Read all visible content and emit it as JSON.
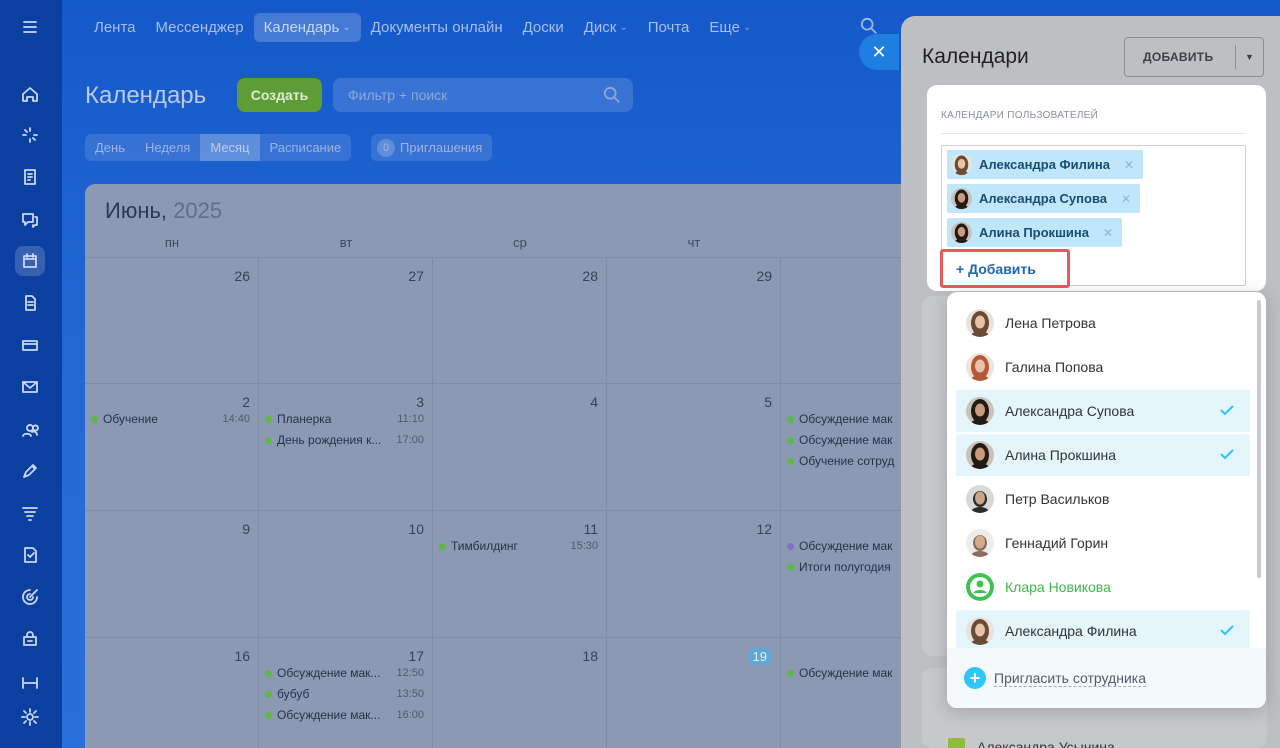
{
  "topnav": {
    "items": [
      {
        "label": "Лента",
        "dropdown": false,
        "active": false
      },
      {
        "label": "Мессенджер",
        "dropdown": false,
        "active": false
      },
      {
        "label": "Календарь",
        "dropdown": true,
        "active": true
      },
      {
        "label": "Документы онлайн",
        "dropdown": false,
        "active": false
      },
      {
        "label": "Доски",
        "dropdown": false,
        "active": false
      },
      {
        "label": "Диск",
        "dropdown": true,
        "active": false
      },
      {
        "label": "Почта",
        "dropdown": false,
        "active": false
      },
      {
        "label": "Еще",
        "dropdown": true,
        "active": false
      }
    ]
  },
  "header": {
    "title": "Календарь",
    "create_label": "Создать",
    "filter_placeholder": "Фильтр + поиск"
  },
  "views": {
    "tabs": [
      "День",
      "Неделя",
      "Месяц",
      "Расписание"
    ],
    "active": "Месяц",
    "invitations_count": "0",
    "invitations_label": "Приглашения"
  },
  "calendar": {
    "month": "Июнь,",
    "year": "2025",
    "weekdays": [
      "пн",
      "вт",
      "ср",
      "чт"
    ],
    "weeks": [
      {
        "days": [
          {
            "num": "26",
            "events": []
          },
          {
            "num": "27",
            "events": []
          },
          {
            "num": "28",
            "events": []
          },
          {
            "num": "29",
            "events": []
          },
          {
            "num": "",
            "events": []
          }
        ]
      },
      {
        "days": [
          {
            "num": "2",
            "events": [
              {
                "title": "Обучение",
                "time": "14:40",
                "color": "#5db846"
              }
            ]
          },
          {
            "num": "3",
            "events": [
              {
                "title": "Планерка",
                "time": "11:10",
                "color": "#5db846"
              },
              {
                "title": "День рождения к...",
                "time": "17:00",
                "color": "#5db846"
              }
            ]
          },
          {
            "num": "4",
            "events": []
          },
          {
            "num": "5",
            "events": []
          },
          {
            "num": "",
            "events": [
              {
                "title": "Обсуждение мак",
                "time": "",
                "color": "#5db846"
              },
              {
                "title": "Обсуждение мак",
                "time": "",
                "color": "#5db846"
              },
              {
                "title": "Обучение сотруд",
                "time": "",
                "color": "#5db846"
              }
            ]
          }
        ]
      },
      {
        "days": [
          {
            "num": "9",
            "events": []
          },
          {
            "num": "10",
            "events": []
          },
          {
            "num": "11",
            "events": [
              {
                "title": "Тимбилдинг",
                "time": "15:30",
                "color": "#5db846"
              }
            ]
          },
          {
            "num": "12",
            "events": []
          },
          {
            "num": "",
            "events": [
              {
                "title": "Обсуждение мак",
                "time": "",
                "color": "#8a6cc0"
              },
              {
                "title": "Итоги полугодия",
                "time": "",
                "color": "#5db846"
              }
            ]
          }
        ]
      },
      {
        "days": [
          {
            "num": "16",
            "events": []
          },
          {
            "num": "17",
            "events": [
              {
                "title": "Обсуждение мак...",
                "time": "12:50",
                "color": "#5db846"
              },
              {
                "title": "бубуб",
                "time": "13:50",
                "color": "#5db846"
              },
              {
                "title": "Обсуждение мак...",
                "time": "16:00",
                "color": "#5db846"
              }
            ]
          },
          {
            "num": "18",
            "events": []
          },
          {
            "num": "19",
            "today": true,
            "events": []
          },
          {
            "num": "",
            "events": [
              {
                "title": "Обсуждение мак",
                "time": "",
                "color": "#5db846"
              }
            ]
          }
        ]
      }
    ]
  },
  "panel": {
    "title": "Календари",
    "add_label": "ДОБАВИТЬ",
    "users_label": "КАЛЕНДАРИ ПОЛЬЗОВАТЕЛЕЙ",
    "selected": [
      {
        "name": "Александра Филина",
        "avatar": "woman-light"
      },
      {
        "name": "Александра Супова",
        "avatar": "woman-dark"
      },
      {
        "name": "Алина Прокшина",
        "avatar": "woman-dark"
      }
    ],
    "add_user_label": "+ Добавить",
    "dropdown": [
      {
        "name": "Лена Петрова",
        "selected": false,
        "avatar": "woman-light"
      },
      {
        "name": "Галина Попова",
        "selected": false,
        "avatar": "woman-red"
      },
      {
        "name": "Александра Супова",
        "selected": true,
        "avatar": "woman-dark"
      },
      {
        "name": "Алина Прокшина",
        "selected": true,
        "avatar": "woman-dark"
      },
      {
        "name": "Петр Васильков",
        "selected": false,
        "avatar": "man-dark"
      },
      {
        "name": "Геннадий Горин",
        "selected": false,
        "avatar": "man-bald"
      },
      {
        "name": "Клара Новикова",
        "selected": false,
        "avatar": "placeholder-green",
        "highlight": true
      },
      {
        "name": "Александра Филина",
        "selected": true,
        "avatar": "woman-light"
      }
    ],
    "invite_label": "Пригласить сотрудника",
    "bottom_user": "Александра Усынина",
    "accent": "#2fc6f6",
    "checkmark_color": "#2fc6f6"
  }
}
